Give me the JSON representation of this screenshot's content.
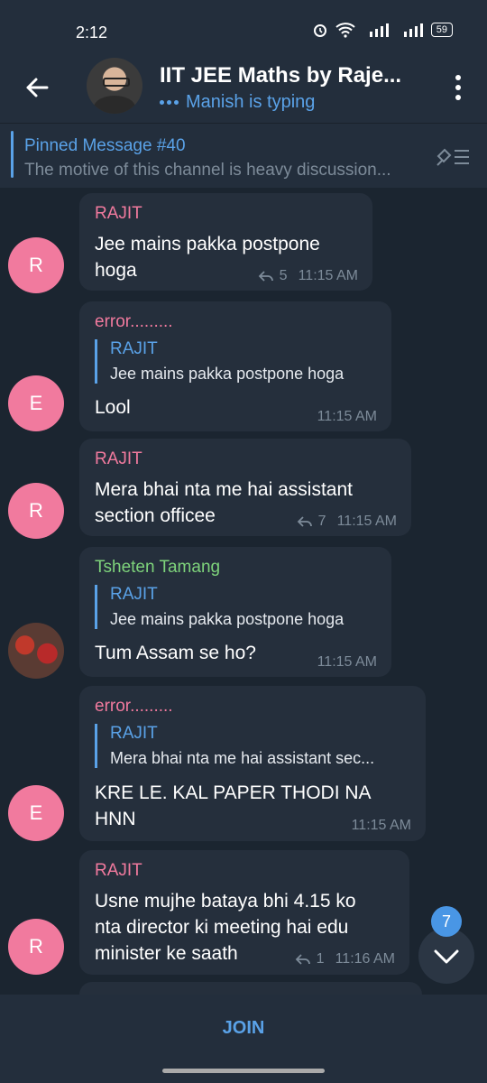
{
  "status_bar": {
    "time": "2:12",
    "battery": "59"
  },
  "header": {
    "title": "IIT JEE Maths by Raje...",
    "subtitle": "Manish is typing"
  },
  "pinned": {
    "title": "Pinned Message #40",
    "text": "The motive of this channel is heavy discussion..."
  },
  "messages": [
    {
      "sender": "RAJIT",
      "avatar": "R",
      "lines": [
        "Jee mains pakka postpone",
        "hoga"
      ],
      "replies_count": "5",
      "time": "11:15 AM"
    },
    {
      "sender": "error.........",
      "avatar": "E",
      "reply_to": {
        "name": "RAJIT",
        "text": "Jee mains pakka postpone hoga"
      },
      "lines": [
        "Lool"
      ],
      "time": "11:15 AM"
    },
    {
      "sender": "RAJIT",
      "avatar": "R",
      "lines": [
        "Mera bhai nta me hai assistant",
        "section officee"
      ],
      "replies_count": "7",
      "time": "11:15 AM"
    },
    {
      "sender": "Tsheten Tamang",
      "reply_to": {
        "name": "RAJIT",
        "text": "Jee mains pakka postpone hoga"
      },
      "lines": [
        "Tum Assam se ho?"
      ],
      "time": "11:15 AM"
    },
    {
      "sender": "error.........",
      "avatar": "E",
      "reply_to": {
        "name": "RAJIT",
        "text": "Mera bhai nta me hai assistant sec..."
      },
      "lines": [
        "KRE LE. KAL PAPER THODI NA",
        "HNN"
      ],
      "time": "11:15 AM"
    },
    {
      "sender": "RAJIT",
      "avatar": "R",
      "lines": [
        "Usne mujhe bataya bhi 4.15 ko",
        "nta director ki meeting hai edu",
        "minister ke saath"
      ],
      "replies_count": "1",
      "time": "11:16 AM"
    }
  ],
  "scroll_badge": "7",
  "join_label": "JOIN",
  "colors": {
    "accent": "#5aa2e8",
    "avatar_pink": "#f17a9e",
    "name_green": "#7ed37b"
  }
}
